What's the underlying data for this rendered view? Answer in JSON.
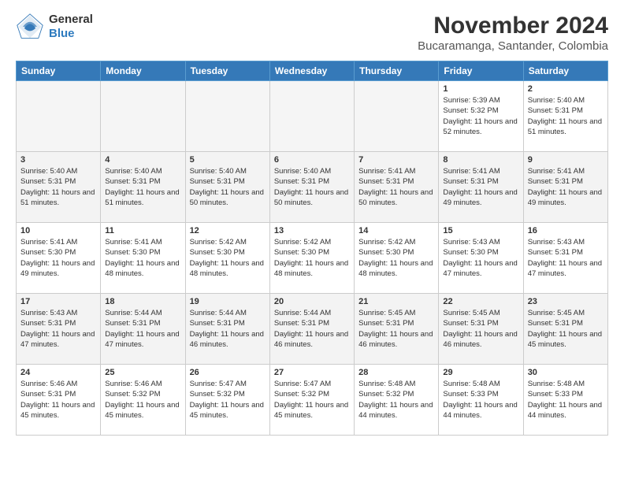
{
  "logo": {
    "line1": "General",
    "line2": "Blue"
  },
  "title": "November 2024",
  "subtitle": "Bucaramanga, Santander, Colombia",
  "weekdays": [
    "Sunday",
    "Monday",
    "Tuesday",
    "Wednesday",
    "Thursday",
    "Friday",
    "Saturday"
  ],
  "weeks": [
    [
      {
        "day": "",
        "info": ""
      },
      {
        "day": "",
        "info": ""
      },
      {
        "day": "",
        "info": ""
      },
      {
        "day": "",
        "info": ""
      },
      {
        "day": "",
        "info": ""
      },
      {
        "day": "1",
        "info": "Sunrise: 5:39 AM\nSunset: 5:32 PM\nDaylight: 11 hours and 52 minutes."
      },
      {
        "day": "2",
        "info": "Sunrise: 5:40 AM\nSunset: 5:31 PM\nDaylight: 11 hours and 51 minutes."
      }
    ],
    [
      {
        "day": "3",
        "info": "Sunrise: 5:40 AM\nSunset: 5:31 PM\nDaylight: 11 hours and 51 minutes."
      },
      {
        "day": "4",
        "info": "Sunrise: 5:40 AM\nSunset: 5:31 PM\nDaylight: 11 hours and 51 minutes."
      },
      {
        "day": "5",
        "info": "Sunrise: 5:40 AM\nSunset: 5:31 PM\nDaylight: 11 hours and 50 minutes."
      },
      {
        "day": "6",
        "info": "Sunrise: 5:40 AM\nSunset: 5:31 PM\nDaylight: 11 hours and 50 minutes."
      },
      {
        "day": "7",
        "info": "Sunrise: 5:41 AM\nSunset: 5:31 PM\nDaylight: 11 hours and 50 minutes."
      },
      {
        "day": "8",
        "info": "Sunrise: 5:41 AM\nSunset: 5:31 PM\nDaylight: 11 hours and 49 minutes."
      },
      {
        "day": "9",
        "info": "Sunrise: 5:41 AM\nSunset: 5:31 PM\nDaylight: 11 hours and 49 minutes."
      }
    ],
    [
      {
        "day": "10",
        "info": "Sunrise: 5:41 AM\nSunset: 5:30 PM\nDaylight: 11 hours and 49 minutes."
      },
      {
        "day": "11",
        "info": "Sunrise: 5:41 AM\nSunset: 5:30 PM\nDaylight: 11 hours and 48 minutes."
      },
      {
        "day": "12",
        "info": "Sunrise: 5:42 AM\nSunset: 5:30 PM\nDaylight: 11 hours and 48 minutes."
      },
      {
        "day": "13",
        "info": "Sunrise: 5:42 AM\nSunset: 5:30 PM\nDaylight: 11 hours and 48 minutes."
      },
      {
        "day": "14",
        "info": "Sunrise: 5:42 AM\nSunset: 5:30 PM\nDaylight: 11 hours and 48 minutes."
      },
      {
        "day": "15",
        "info": "Sunrise: 5:43 AM\nSunset: 5:30 PM\nDaylight: 11 hours and 47 minutes."
      },
      {
        "day": "16",
        "info": "Sunrise: 5:43 AM\nSunset: 5:31 PM\nDaylight: 11 hours and 47 minutes."
      }
    ],
    [
      {
        "day": "17",
        "info": "Sunrise: 5:43 AM\nSunset: 5:31 PM\nDaylight: 11 hours and 47 minutes."
      },
      {
        "day": "18",
        "info": "Sunrise: 5:44 AM\nSunset: 5:31 PM\nDaylight: 11 hours and 47 minutes."
      },
      {
        "day": "19",
        "info": "Sunrise: 5:44 AM\nSunset: 5:31 PM\nDaylight: 11 hours and 46 minutes."
      },
      {
        "day": "20",
        "info": "Sunrise: 5:44 AM\nSunset: 5:31 PM\nDaylight: 11 hours and 46 minutes."
      },
      {
        "day": "21",
        "info": "Sunrise: 5:45 AM\nSunset: 5:31 PM\nDaylight: 11 hours and 46 minutes."
      },
      {
        "day": "22",
        "info": "Sunrise: 5:45 AM\nSunset: 5:31 PM\nDaylight: 11 hours and 46 minutes."
      },
      {
        "day": "23",
        "info": "Sunrise: 5:45 AM\nSunset: 5:31 PM\nDaylight: 11 hours and 45 minutes."
      }
    ],
    [
      {
        "day": "24",
        "info": "Sunrise: 5:46 AM\nSunset: 5:31 PM\nDaylight: 11 hours and 45 minutes."
      },
      {
        "day": "25",
        "info": "Sunrise: 5:46 AM\nSunset: 5:32 PM\nDaylight: 11 hours and 45 minutes."
      },
      {
        "day": "26",
        "info": "Sunrise: 5:47 AM\nSunset: 5:32 PM\nDaylight: 11 hours and 45 minutes."
      },
      {
        "day": "27",
        "info": "Sunrise: 5:47 AM\nSunset: 5:32 PM\nDaylight: 11 hours and 45 minutes."
      },
      {
        "day": "28",
        "info": "Sunrise: 5:48 AM\nSunset: 5:32 PM\nDaylight: 11 hours and 44 minutes."
      },
      {
        "day": "29",
        "info": "Sunrise: 5:48 AM\nSunset: 5:33 PM\nDaylight: 11 hours and 44 minutes."
      },
      {
        "day": "30",
        "info": "Sunrise: 5:48 AM\nSunset: 5:33 PM\nDaylight: 11 hours and 44 minutes."
      }
    ]
  ]
}
